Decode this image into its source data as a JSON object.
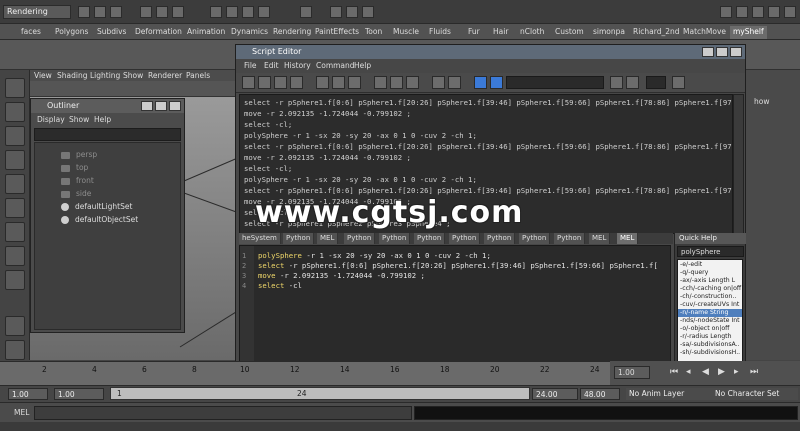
{
  "status_bar": {
    "mode": "Rendering"
  },
  "shelf": {
    "tabs": [
      "faces",
      "Polygons",
      "Subdivs",
      "Deformation",
      "Animation",
      "Dynamics",
      "Rendering",
      "PaintEffects",
      "Toon",
      "Muscle",
      "Fluids",
      "Fur",
      "Hair",
      "nCloth",
      "Custom",
      "simonpa",
      "Richard_2nd",
      "MatchMove",
      "myShelf"
    ],
    "active_tab": "myShelf"
  },
  "viewport": {
    "menu": [
      "View",
      "Shading",
      "Lighting",
      "Show",
      "Renderer",
      "Panels"
    ],
    "right_label": "how"
  },
  "outliner": {
    "title": "Outliner",
    "menu": [
      "Display",
      "Show",
      "Help"
    ],
    "items": [
      {
        "label": "persp",
        "dim": true
      },
      {
        "label": "top",
        "dim": true
      },
      {
        "label": "front",
        "dim": true
      },
      {
        "label": "side",
        "dim": true
      },
      {
        "label": "defaultLightSet",
        "dim": false
      },
      {
        "label": "defaultObjectSet",
        "dim": false
      }
    ]
  },
  "script_editor": {
    "title": "Script Editor",
    "menu": [
      "File",
      "Edit",
      "History",
      "Command",
      "Help"
    ],
    "history": [
      "select -r pSphere1.f[0:6] pSphere1.f[20:26] pSphere1.f[39:46] pSphere1.f[59:66] pSphere1.f[78:86] pSphere1.f[97:",
      "move -r 2.092135 -1.724044 -0.799102 ;",
      "select -cl;",
      "polySphere -r 1 -sx 20 -sy 20 -ax 0 1 0 -cuv 2 -ch 1;",
      "select -r pSphere1.f[0:6] pSphere1.f[20:26] pSphere1.f[39:46] pSphere1.f[59:66] pSphere1.f[78:86] pSphere1.f[97:",
      "move -r 2.092135 -1.724044 -0.799102 ;",
      "select -cl;",
      "polySphere -r 1 -sx 20 -sy 20 -ax 0 1 0 -cuv 2 -ch 1;",
      "select -r pSphere1.f[0:6] pSphere1.f[20:26] pSphere1.f[39:46] pSphere1.f[59:66] pSphere1.f[78:86] pSphere1.f[97:",
      "move -r 2.092135 -1.724044 -0.799102 ;",
      "select -cl;",
      "select -r pSphere1 pSphere2 pSphere3 pSphere4 ;"
    ],
    "input_tabs": [
      "heSystem",
      "Python",
      "MEL",
      "Python",
      "Python",
      "Python",
      "Python",
      "Python",
      "Python",
      "Python",
      "MEL",
      "MEL"
    ],
    "active_input_tab": 11,
    "input_lines": [
      {
        "num": "1",
        "kw": "polySphere",
        "rest": " -r 1 -sx 20 -sy 20 -ax 0 1 0 -cuv 2 -ch 1;"
      },
      {
        "num": "2",
        "kw": "select",
        "rest": " -r pSphere1.f[0:6] pSphere1.f[20:26] pSphere1.f[39:46] pSphere1.f[59:66] pSphere1.f["
      },
      {
        "num": "3",
        "kw": "move",
        "rest": " -r 2.092135 -1.724044 -0.799102 ;"
      },
      {
        "num": "4",
        "kw": "select",
        "rest": " -cl"
      }
    ],
    "quick_help": {
      "tab": "Quick Help",
      "field": "polySphere",
      "entries": [
        "-e/-edit",
        "-q/-query",
        "-ax/-axis Length L",
        "-cch/-caching on|off",
        "-ch/-construction..",
        "-cuv/-createUVs Int",
        "-n/-name String",
        "-nds/-nodeState Int",
        "-o/-object on|off",
        "-r/-radius Length",
        "-sa/-subdivisionsA..",
        "-sh/-subdivisionsH.."
      ],
      "selected": 6
    }
  },
  "watermark": "www.cgtsj.com",
  "timeline": {
    "ticks": [
      "2",
      "4",
      "6",
      "8",
      "10",
      "12",
      "14",
      "16",
      "18",
      "20",
      "22",
      "24"
    ],
    "current_frame": "1.00",
    "range_start": "1.00",
    "range_start2": "1.00",
    "range_slider_start": "1",
    "range_slider_end": "24",
    "range_end": "24.00",
    "range_end2": "48.00",
    "anim_layer": "No Anim Layer",
    "character_set": "No Character Set"
  },
  "command_line": {
    "label": "MEL"
  }
}
